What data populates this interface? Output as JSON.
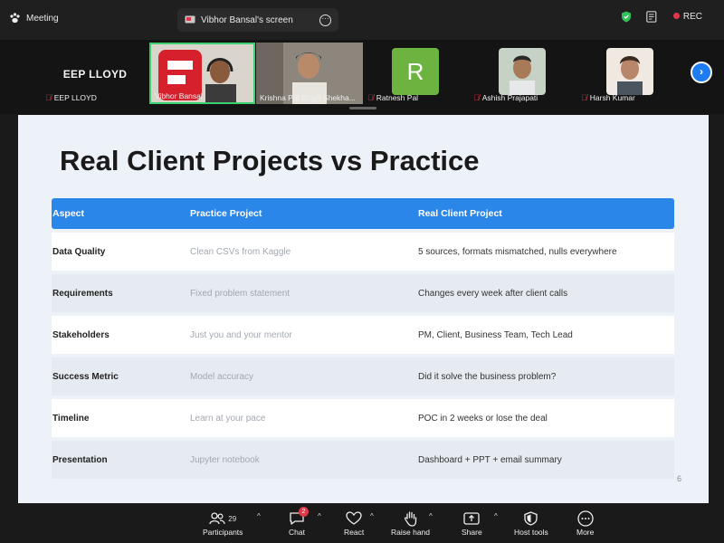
{
  "topbar": {
    "meeting_label": "Meeting",
    "share_label": "Vibhor Bansal's screen",
    "rec_label": "REC"
  },
  "participants": {
    "eep_name": "EEP LLOYD",
    "tiles": [
      {
        "name": "EEP LLOYD",
        "muted": true
      },
      {
        "name": "Vibhor Bansal",
        "muted": false
      },
      {
        "name": "Krishna Pal Singh Shekha...",
        "muted": false
      },
      {
        "name": "Ratnesh Pal",
        "muted": true,
        "initial": "R"
      },
      {
        "name": "Ashish Prajapati",
        "muted": true
      },
      {
        "name": "Harsh Kumar",
        "muted": true
      }
    ]
  },
  "slide": {
    "title": "Real Client Projects vs Practice",
    "headers": [
      "Aspect",
      "Practice Project",
      "Real Client Project"
    ],
    "rows": [
      [
        "Data Quality",
        "Clean CSVs from Kaggle",
        "5 sources, formats mismatched, nulls everywhere"
      ],
      [
        "Requirements",
        "Fixed problem statement",
        "Changes every week after client calls"
      ],
      [
        "Stakeholders",
        "Just you and your mentor",
        "PM, Client, Business Team, Tech Lead"
      ],
      [
        "Success Metric",
        "Model accuracy",
        "Did it solve the business problem?"
      ],
      [
        "Timeline",
        "Learn at your pace",
        "POC in 2 weeks or lose the deal"
      ],
      [
        "Presentation",
        "Jupyter notebook",
        "Dashboard + PPT + email summary"
      ]
    ],
    "page_number": "6"
  },
  "toolbar": {
    "participants_label": "Participants",
    "participants_count": "29",
    "chat_label": "Chat",
    "chat_badge": "2",
    "react_label": "React",
    "raise_hand_label": "Raise hand",
    "share_label": "Share",
    "host_tools_label": "Host tools",
    "more_label": "More"
  },
  "colors": {
    "accent": "#2b86ea",
    "rec": "#e0384a",
    "speaker_border": "#3ccf6e",
    "ratnesh_avatar": "#6cb33f"
  }
}
